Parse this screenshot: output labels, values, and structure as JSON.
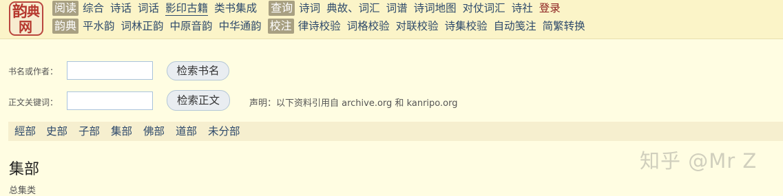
{
  "logo": {
    "chars": [
      "韵",
      "典",
      "网"
    ]
  },
  "nav": {
    "row1_tag_1": "阅读",
    "row1_links_1": [
      "综合",
      "诗话",
      "词话",
      "影印古籍",
      "类书集成"
    ],
    "row1_tag_2": "查询",
    "row1_links_2": [
      "诗词",
      "典故、词汇",
      "词谱",
      "诗词地图",
      "对仗词汇",
      "诗社"
    ],
    "login": "登录",
    "row2_tag_1": "韵典",
    "row2_links_1": [
      "平水韵",
      "词林正韵",
      "中原音韵",
      "中华通韵"
    ],
    "row2_tag_2": "校注",
    "row2_links_2": [
      "律诗校验",
      "词格校验",
      "对联校验",
      "诗集校验",
      "自动笺注",
      "简繁转换"
    ]
  },
  "search": {
    "book_label": "书名或作者：",
    "book_value": "",
    "book_button": "检索书名",
    "text_label": "正文关键词：",
    "text_value": "",
    "text_button": "检索正文",
    "notice": "声明：以下资料引用自 archive.org 和 kanripo.org"
  },
  "categories": [
    "經部",
    "史部",
    "子部",
    "集部",
    "佛部",
    "道部",
    "未分部"
  ],
  "section_title": "集部",
  "sub_label": "总集类",
  "watermark": "知乎 @Mr Z",
  "colors": {
    "nav_bg": "#fbf4c8",
    "tag_bg": "#a8a082",
    "link": "#2e4a6b",
    "login": "#8a1d1d",
    "page_bg": "#fffde2",
    "seal": "#b5362d"
  }
}
